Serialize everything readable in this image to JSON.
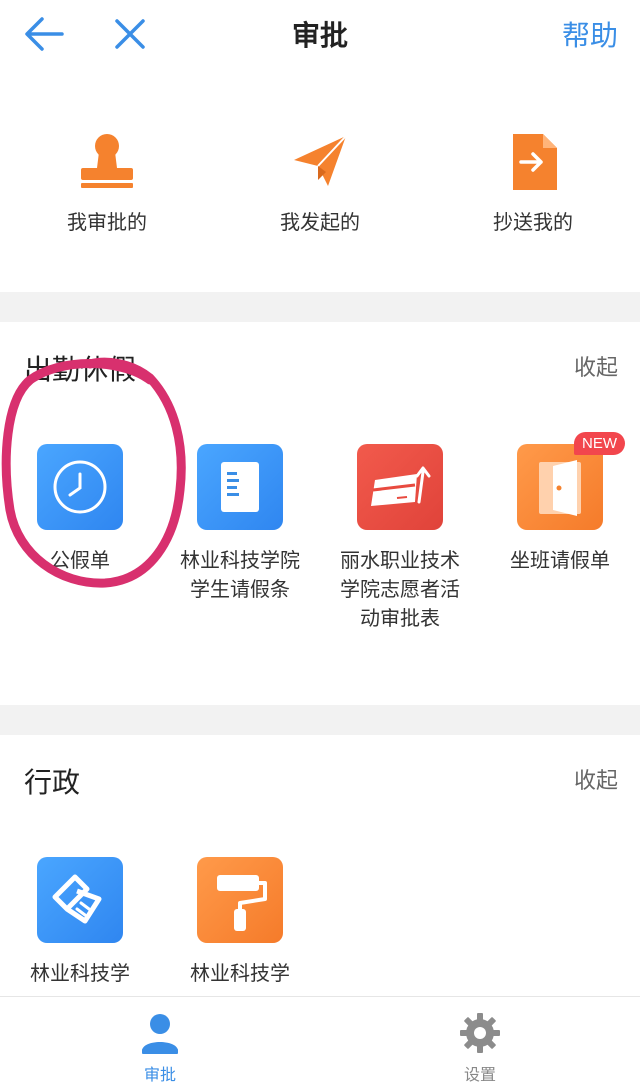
{
  "header": {
    "title": "审批",
    "help_label": "帮助",
    "back_icon": "arrow-left-icon",
    "close_icon": "close-icon"
  },
  "quick_actions": [
    {
      "label": "我审批的",
      "icon": "stamp-icon"
    },
    {
      "label": "我发起的",
      "icon": "paper-plane-icon"
    },
    {
      "label": "抄送我的",
      "icon": "document-forward-icon"
    }
  ],
  "sections": [
    {
      "title": "出勤休假",
      "collapse_label": "收起",
      "apps": [
        {
          "name": "公假单",
          "icon": "clock-icon",
          "color": "#3a8ee6"
        },
        {
          "name": "林业科技学院学生请假条",
          "icon": "document-icon",
          "color": "#3a8ee6"
        },
        {
          "name": "丽水职业技术学院志愿者活动审批表",
          "icon": "card-growth-icon",
          "color": "#e84a3f"
        },
        {
          "name": "坐班请假单",
          "icon": "door-exit-icon",
          "color": "#f5822e",
          "badge": "NEW"
        }
      ]
    },
    {
      "title": "行政",
      "collapse_label": "收起",
      "apps": [
        {
          "name": "林业科技学",
          "icon": "handshake-icon",
          "color": "#3a8ee6"
        },
        {
          "name": "林业科技学",
          "icon": "paint-roller-icon",
          "color": "#f5822e"
        }
      ]
    }
  ],
  "bottom_nav": [
    {
      "label": "审批",
      "icon": "person-icon",
      "active": true
    },
    {
      "label": "设置",
      "icon": "gear-icon",
      "active": false
    }
  ],
  "colors": {
    "accent": "#3a8ee6",
    "orange": "#f5822e",
    "annotation": "#d8306e"
  }
}
